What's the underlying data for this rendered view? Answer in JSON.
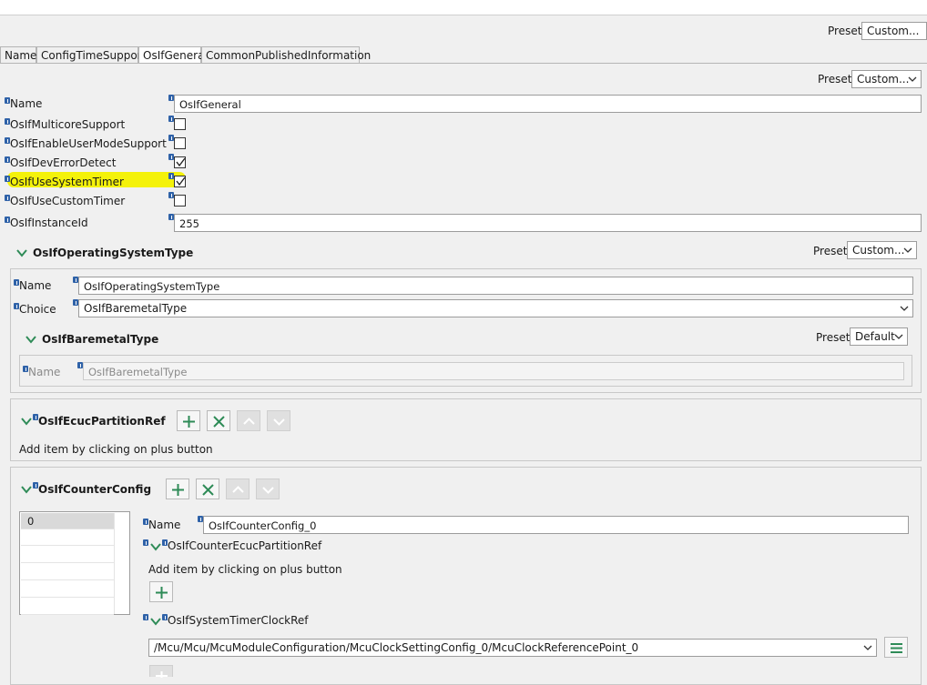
{
  "preset_label": "Preset",
  "top_preset": {
    "value": "Custom..."
  },
  "tabs": [
    {
      "label": "Name",
      "active": false
    },
    {
      "label": "ConfigTimeSupport",
      "active": false
    },
    {
      "label": "OsIfGeneral",
      "active": true
    },
    {
      "label": "CommonPublishedInformation",
      "active": false
    }
  ],
  "general": {
    "preset": "Custom...",
    "fields": {
      "name": {
        "label": "Name",
        "value": "OsIfGeneral"
      },
      "multicore": {
        "label": "OsIfMulticoreSupport",
        "checked": false
      },
      "usermode": {
        "label": "OsIfEnableUserModeSupport",
        "checked": false
      },
      "deverror": {
        "label": "OsIfDevErrorDetect",
        "checked": true
      },
      "systemtimer": {
        "label": "OsIfUseSystemTimer",
        "checked": true,
        "highlight_color": "#f4f20a"
      },
      "customtimer": {
        "label": "OsIfUseCustomTimer",
        "checked": false
      },
      "instanceid": {
        "label": "OsIfInstanceId",
        "value": "255"
      }
    }
  },
  "os_type": {
    "title": "OsIfOperatingSystemType",
    "preset": "Custom...",
    "name": {
      "label": "Name",
      "value": "OsIfOperatingSystemType"
    },
    "choice": {
      "label": "Choice",
      "value": "OsIfBaremetalType"
    },
    "baremetal": {
      "title": "OsIfBaremetalType",
      "preset": "Default",
      "name": {
        "label": "Name",
        "value": "OsIfBaremetalType"
      }
    }
  },
  "ecuc_partition": {
    "title": "OsIfEcucPartitionRef",
    "hint": "Add item by clicking on plus button"
  },
  "counter_config": {
    "title": "OsIfCounterConfig",
    "list_items": [
      "0"
    ],
    "name": {
      "label": "Name",
      "value": "OsIfCounterConfig_0"
    },
    "ecuc_ref": {
      "title": "OsIfCounterEcucPartitionRef",
      "hint": "Add item by clicking on plus button"
    },
    "clock_ref": {
      "title": "OsIfSystemTimerClockRef",
      "value": "/Mcu/Mcu/McuModuleConfiguration/McuClockSettingConfig_0/McuClockReferencePoint_0"
    }
  },
  "icons": {
    "info": "info-icon",
    "add": "plus-icon",
    "delete": "x-icon",
    "up": "arrow-up-icon",
    "down": "arrow-down-icon",
    "expand": "chevron-down-icon",
    "menu": "hamburger-icon"
  },
  "colors": {
    "accent_green": "#2e8b57",
    "info_blue": "#2f62a8",
    "highlight": "#f4f20a"
  }
}
